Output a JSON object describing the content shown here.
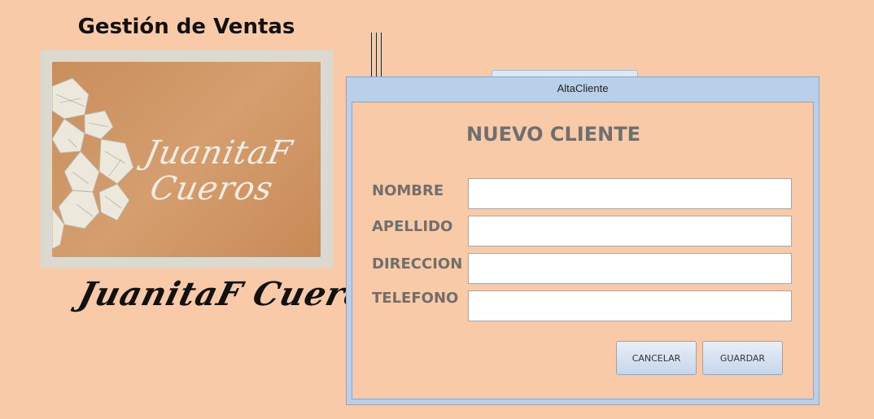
{
  "app": {
    "title": "Gestión de Ventas",
    "logo_text_line1": "JuanitaF",
    "logo_text_line2": "Cueros",
    "brand_name": "JuanitaF Cueros"
  },
  "dialog": {
    "title": "AltaCliente",
    "form_title": "NUEVO CLIENTE",
    "fields": [
      {
        "label": "NOMBRE",
        "value": ""
      },
      {
        "label": "APELLIDO",
        "value": ""
      },
      {
        "label": "DIRECCION",
        "value": ""
      },
      {
        "label": "TELEFONO",
        "value": ""
      }
    ],
    "buttons": {
      "cancel": "CANCELAR",
      "save": "GUARDAR"
    }
  },
  "colors": {
    "background": "#f9caa7",
    "dialog_frame": "#b8d0ea",
    "label_text": "#6f6f6f"
  }
}
